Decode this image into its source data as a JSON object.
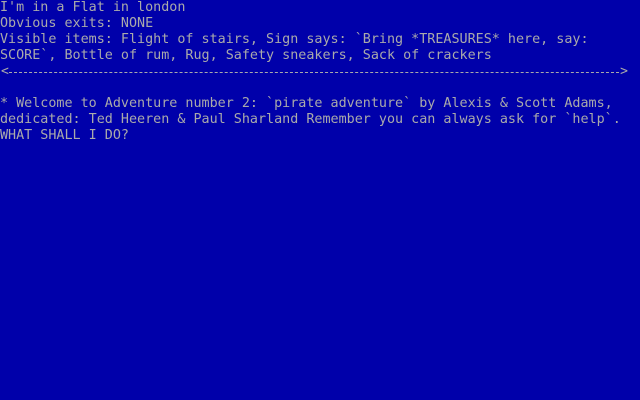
{
  "room": {
    "description": "I'm in a Flat in london",
    "exits": "Obvious exits: NONE",
    "items_line_1": "Visible items: Flight of stairs, Sign says: `Bring *TREASURES* here, say:",
    "items_line_2": "SCORE`, Bottle of rum, Rug, Safety sneakers, Sack of crackers"
  },
  "divider": {
    "left_arrow": "<",
    "right_arrow": ">"
  },
  "messages": {
    "line_1": "* Welcome to Adventure number 2: `pirate adventure` by Alexis & Scott Adams,",
    "line_2": "dedicated: Ted Heeren & Paul Sharland Remember you can always ask for `help`.",
    "prompt": "WHAT SHALL I DO?"
  },
  "command": {
    "value": ""
  },
  "colors": {
    "background": "#0000aa",
    "text": "#aaaaaa"
  }
}
